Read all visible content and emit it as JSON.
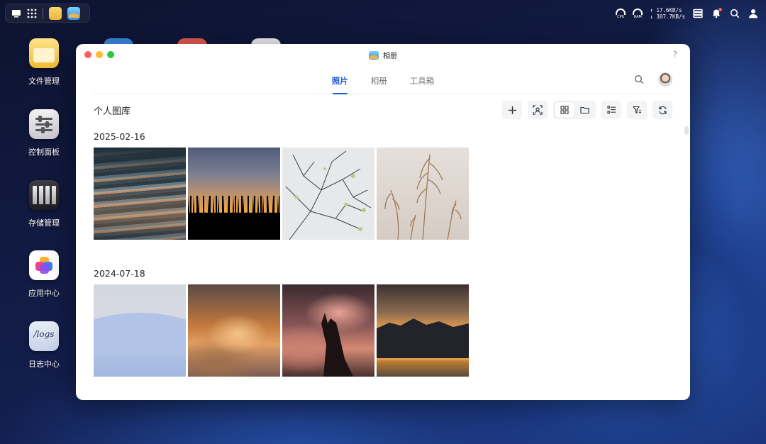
{
  "taskbar": {
    "apps": [
      "file-manager",
      "photos"
    ]
  },
  "tray": {
    "cpu_label": "CPU",
    "ram_label": "RAM",
    "upload_speed": "↑ 17.6KB/s",
    "download_speed": "↓ 307.7KB/s"
  },
  "desktop": {
    "icons": [
      {
        "label": "文件管理"
      },
      {
        "label": "控制面板"
      },
      {
        "label": "存储管理"
      },
      {
        "label": "应用中心"
      },
      {
        "label": "日志中心"
      }
    ],
    "logs_icon_text": "/logs"
  },
  "window": {
    "title": "相册",
    "help": "?",
    "tabs": [
      {
        "label": "照片",
        "active": true
      },
      {
        "label": "相册",
        "active": false
      },
      {
        "label": "工具箱",
        "active": false
      }
    ],
    "library_title": "个人图库",
    "groups": [
      {
        "date": "2025-02-16",
        "photos": [
          "ocean-waves",
          "forest-sunset",
          "bare-branches",
          "pampas-grass"
        ]
      },
      {
        "date": "2024-07-18",
        "photos": [
          "snow-hill",
          "sunset-clouds",
          "hand-silhouette",
          "lake-sunset"
        ]
      }
    ]
  },
  "colors": {
    "accent": "#1a56d6",
    "window_bg": "#ffffff",
    "toolbar_btn_bg": "#f3f4f6"
  }
}
